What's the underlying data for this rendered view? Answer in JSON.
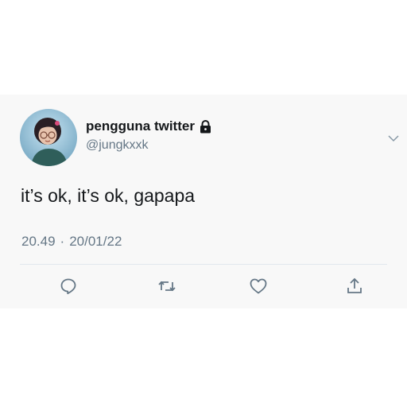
{
  "tweet": {
    "display_name": "pengguna twitter",
    "handle": "@jungkxxk",
    "text": "it’s ok, it’s ok, gapapa",
    "time": "20.49",
    "separator": "·",
    "date": "20/01/22",
    "locked": true
  },
  "icons": {
    "lock": "lock-icon",
    "chevron": "chevron-down-icon",
    "reply": "reply-icon",
    "retweet": "retweet-icon",
    "like": "heart-icon",
    "share": "share-icon"
  },
  "colors": {
    "name": "#14171a",
    "secondary": "#657786",
    "card_background": "#f8f8f8",
    "divider": "#e1e8ed"
  }
}
